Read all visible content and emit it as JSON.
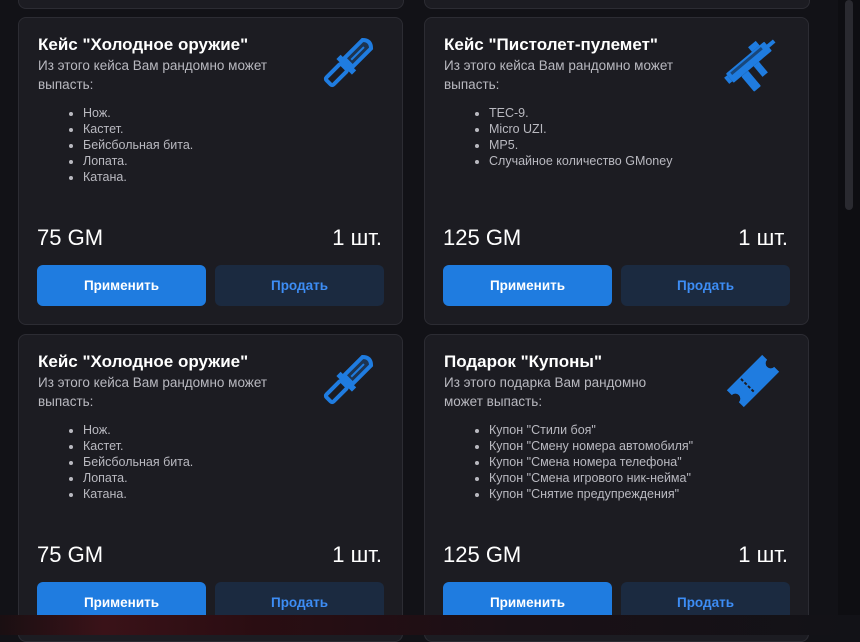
{
  "colors": {
    "accent": "#1f7ce0",
    "sell_bg": "#1b2a40",
    "sell_text": "#3d8df5",
    "card_bg": "#1c1c22",
    "icon": "#1f7ce0"
  },
  "cards": [
    {
      "title": "Кейс \"Холодное оружие\"",
      "desc": "Из этого кейса Вам рандомно может выпасть:",
      "icon": "knife-icon",
      "items": [
        "Нож.",
        "Кастет.",
        "Бейсбольная бита.",
        "Лопата.",
        "Катана."
      ],
      "price": "75 GM",
      "qty": "1 шт.",
      "apply_label": "Применить",
      "sell_label": "Продать"
    },
    {
      "title": "Кейс \"Пистолет-пулемет\"",
      "desc": "Из этого кейса Вам рандомно может выпасть:",
      "icon": "submachine-gun-icon",
      "items": [
        "TEC-9.",
        "Micro UZI.",
        "MP5.",
        "Случайное количество GMoney"
      ],
      "price": "125 GM",
      "qty": "1 шт.",
      "apply_label": "Применить",
      "sell_label": "Продать"
    },
    {
      "title": "Кейс \"Холодное оружие\"",
      "desc": "Из этого кейса Вам рандомно может выпасть:",
      "icon": "knife-icon",
      "items": [
        "Нож.",
        "Кастет.",
        "Бейсбольная бита.",
        "Лопата.",
        "Катана."
      ],
      "price": "75 GM",
      "qty": "1 шт.",
      "apply_label": "Применить",
      "sell_label": "Продать"
    },
    {
      "title": "Подарок \"Купоны\"",
      "desc": "Из этого подарка Вам рандомно может выпасть:",
      "icon": "coupon-ticket-icon",
      "items": [
        "Купон \"Стили боя\"",
        "Купон \"Смену номера автомобиля\"",
        "Купон \"Смена номера телефона\"",
        "Купон \"Смена игрового ник-нейма\"",
        "Купон \"Снятие предупреждения\""
      ],
      "price": "125 GM",
      "qty": "1 шт.",
      "apply_label": "Применить",
      "sell_label": "Продать"
    }
  ]
}
